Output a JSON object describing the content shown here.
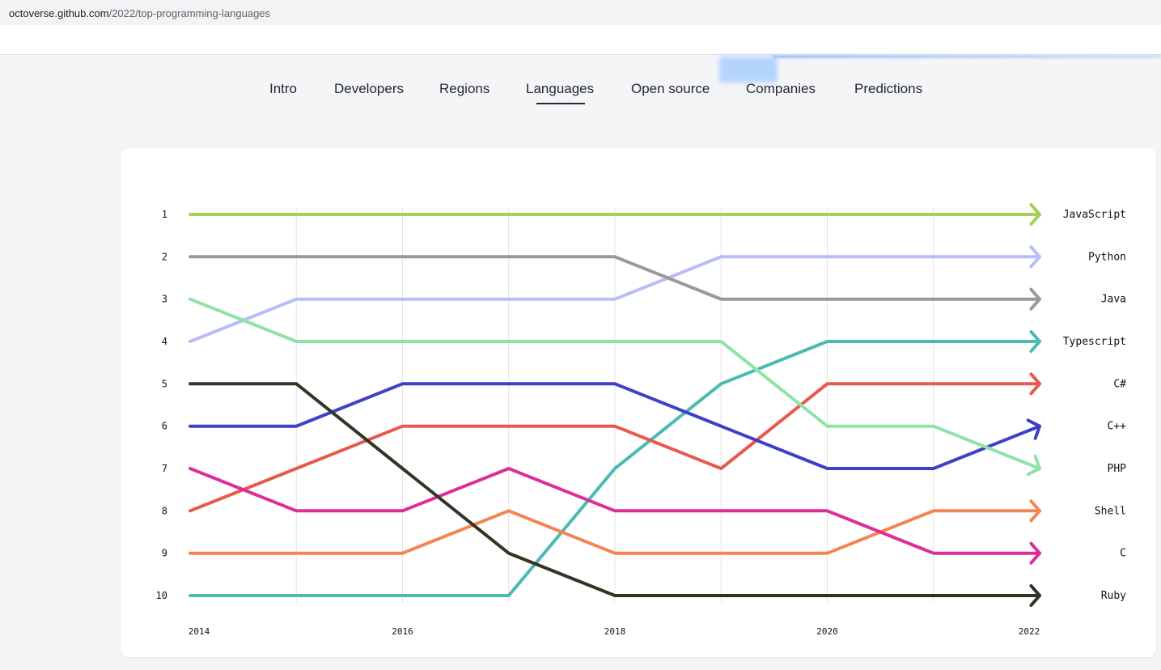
{
  "browser": {
    "url_host": "octoverse.github.com",
    "url_path": "/2022/top-programming-languages"
  },
  "nav": {
    "items": [
      {
        "label": "Intro"
      },
      {
        "label": "Developers"
      },
      {
        "label": "Regions"
      },
      {
        "label": "Languages",
        "active": true
      },
      {
        "label": "Open source"
      },
      {
        "label": "Companies"
      },
      {
        "label": "Predictions"
      }
    ]
  },
  "chart_data": {
    "type": "line",
    "title": "",
    "xlabel": "",
    "ylabel": "",
    "y_axis": "rank (1 at top)",
    "ylim": [
      1,
      10
    ],
    "xlim": [
      2014,
      2022
    ],
    "x": [
      2014,
      2015,
      2016,
      2017,
      2018,
      2019,
      2020,
      2021,
      2022
    ],
    "x_tick_labels": [
      "2014",
      "2016",
      "2018",
      "2020",
      "2022"
    ],
    "y_tick_labels": [
      "1",
      "2",
      "3",
      "4",
      "5",
      "6",
      "7",
      "8",
      "9",
      "10"
    ],
    "grid": "vertical",
    "legend": "labels at right end of each line",
    "series": [
      {
        "name": "JavaScript",
        "color": "#a7cf53",
        "values": [
          1,
          1,
          1,
          1,
          1,
          1,
          1,
          1,
          1
        ]
      },
      {
        "name": "Python",
        "color": "#b9bdf7",
        "values": [
          4,
          3,
          3,
          3,
          3,
          2,
          2,
          2,
          2
        ]
      },
      {
        "name": "Java",
        "color": "#999999",
        "values": [
          2,
          2,
          2,
          2,
          2,
          3,
          3,
          3,
          3
        ]
      },
      {
        "name": "Typescript",
        "color": "#4bbab3",
        "values": [
          10,
          10,
          10,
          10,
          7,
          5,
          4,
          4,
          4
        ]
      },
      {
        "name": "C#",
        "color": "#e8584e",
        "values": [
          8,
          7,
          6,
          6,
          6,
          7,
          5,
          5,
          5
        ]
      },
      {
        "name": "C++",
        "color": "#3f40c9",
        "values": [
          6,
          6,
          5,
          5,
          5,
          6,
          7,
          7,
          6
        ]
      },
      {
        "name": "PHP",
        "color": "#8fe3a6",
        "values": [
          3,
          4,
          4,
          4,
          4,
          4,
          6,
          6,
          7
        ]
      },
      {
        "name": "Shell",
        "color": "#f58452",
        "values": [
          9,
          9,
          9,
          8,
          9,
          9,
          9,
          8,
          8
        ]
      },
      {
        "name": "C",
        "color": "#dd2d9b",
        "values": [
          7,
          8,
          8,
          7,
          8,
          8,
          8,
          9,
          9
        ]
      },
      {
        "name": "Ruby",
        "color": "#343426",
        "values": [
          5,
          5,
          7,
          9,
          10,
          10,
          10,
          10,
          10
        ]
      }
    ]
  }
}
